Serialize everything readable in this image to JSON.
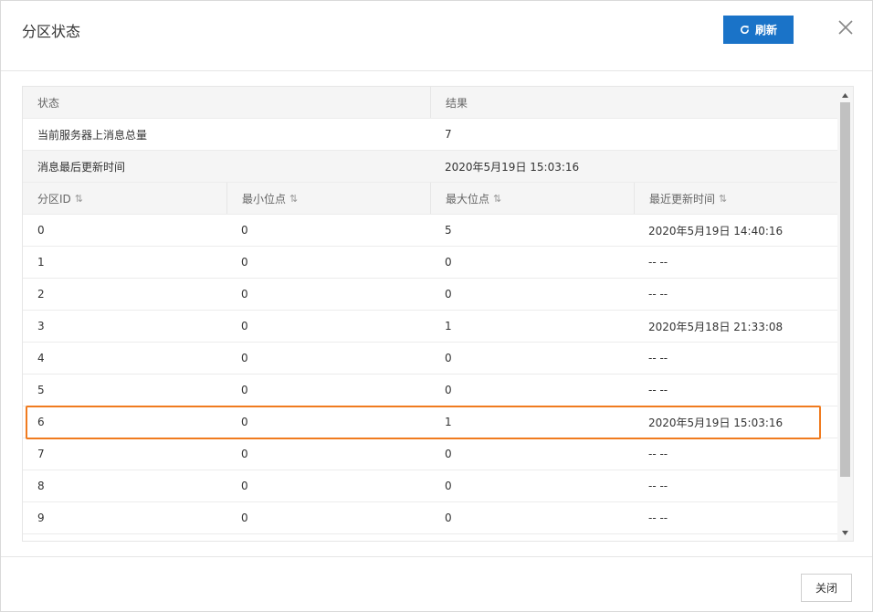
{
  "dialog": {
    "title": "分区状态",
    "refresh_label": "刷新",
    "close_label": "关闭"
  },
  "summary": {
    "headers": [
      "状态",
      "结果"
    ],
    "rows": [
      {
        "label": "当前服务器上消息总量",
        "value": "7"
      },
      {
        "label": "消息最后更新时间",
        "value": "2020年5月19日 15:03:16"
      }
    ]
  },
  "partitions": {
    "headers": [
      "分区ID",
      "最小位点",
      "最大位点",
      "最近更新时间"
    ],
    "rows": [
      {
        "id": "0",
        "min": "0",
        "max": "5",
        "updated": "2020年5月19日 14:40:16"
      },
      {
        "id": "1",
        "min": "0",
        "max": "0",
        "updated": "-- --"
      },
      {
        "id": "2",
        "min": "0",
        "max": "0",
        "updated": "-- --"
      },
      {
        "id": "3",
        "min": "0",
        "max": "1",
        "updated": "2020年5月18日 21:33:08"
      },
      {
        "id": "4",
        "min": "0",
        "max": "0",
        "updated": "-- --"
      },
      {
        "id": "5",
        "min": "0",
        "max": "0",
        "updated": "-- --"
      },
      {
        "id": "6",
        "min": "0",
        "max": "1",
        "updated": "2020年5月19日 15:03:16"
      },
      {
        "id": "7",
        "min": "0",
        "max": "0",
        "updated": "-- --"
      },
      {
        "id": "8",
        "min": "0",
        "max": "0",
        "updated": "-- --"
      },
      {
        "id": "9",
        "min": "0",
        "max": "0",
        "updated": "-- --"
      }
    ]
  },
  "icons": {
    "refresh": "refresh-icon",
    "close": "close-icon",
    "sort": "sort-icon"
  },
  "colors": {
    "primary": "#1a73c8",
    "highlight": "#f07b1f"
  }
}
